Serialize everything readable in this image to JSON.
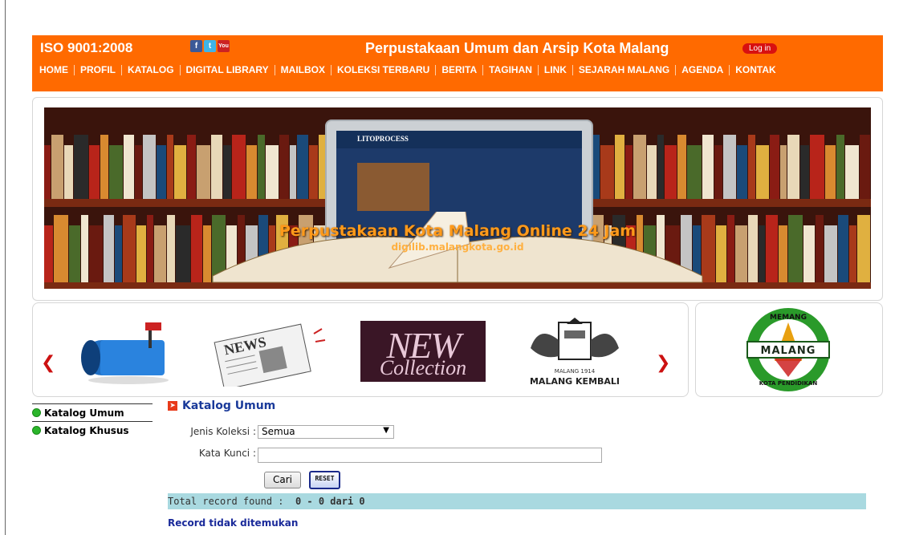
{
  "header": {
    "iso": "ISO 9001:2008",
    "social": {
      "facebook": "f",
      "twitter": "t",
      "youtube": "You"
    },
    "title": "Perpustakaan Umum dan Arsip Kota Malang",
    "login": "Log in",
    "nav": [
      "HOME",
      "PROFIL",
      "KATALOG",
      "DIGITAL LIBRARY",
      "MAILBOX",
      "KOLEKSI TERBARU",
      "BERITA",
      "TAGIHAN",
      "LINK",
      "SEJARAH MALANG",
      "AGENDA",
      "KONTAK"
    ],
    "colors": {
      "bar": "#ff6a00",
      "login": "#d81010"
    }
  },
  "banner": {
    "screen_brand": "LITOPROCESS",
    "headline": "Perpustakaan Kota Malang Online 24 Jam",
    "url": "digilib.malangkota.go.id"
  },
  "carousel": {
    "prev_icon": "chevron-left-icon",
    "next_icon": "chevron-right-icon",
    "news": "NEWS",
    "new_big": "NEW",
    "new_small": "Collection",
    "malang_kembali": "MALANG  KEMBALI",
    "malang_year": "MALANG 1914"
  },
  "logo": {
    "top_text": "MEMANG",
    "center_text": "MALANG",
    "bottom_text": "KOTA PENDIDIKAN"
  },
  "sidebar": {
    "items": [
      "Katalog Umum",
      "Katalog Khusus"
    ]
  },
  "main": {
    "heading": "Katalog Umum",
    "jenis_label": "Jenis Koleksi :",
    "jenis_value": "Semua",
    "kata_label": "Kata Kunci :",
    "cari": "Cari",
    "reset": "RESET",
    "total_label": "Total record found :",
    "total_value": "0 - 0 dari 0",
    "not_found": "Record tidak ditemukan"
  }
}
